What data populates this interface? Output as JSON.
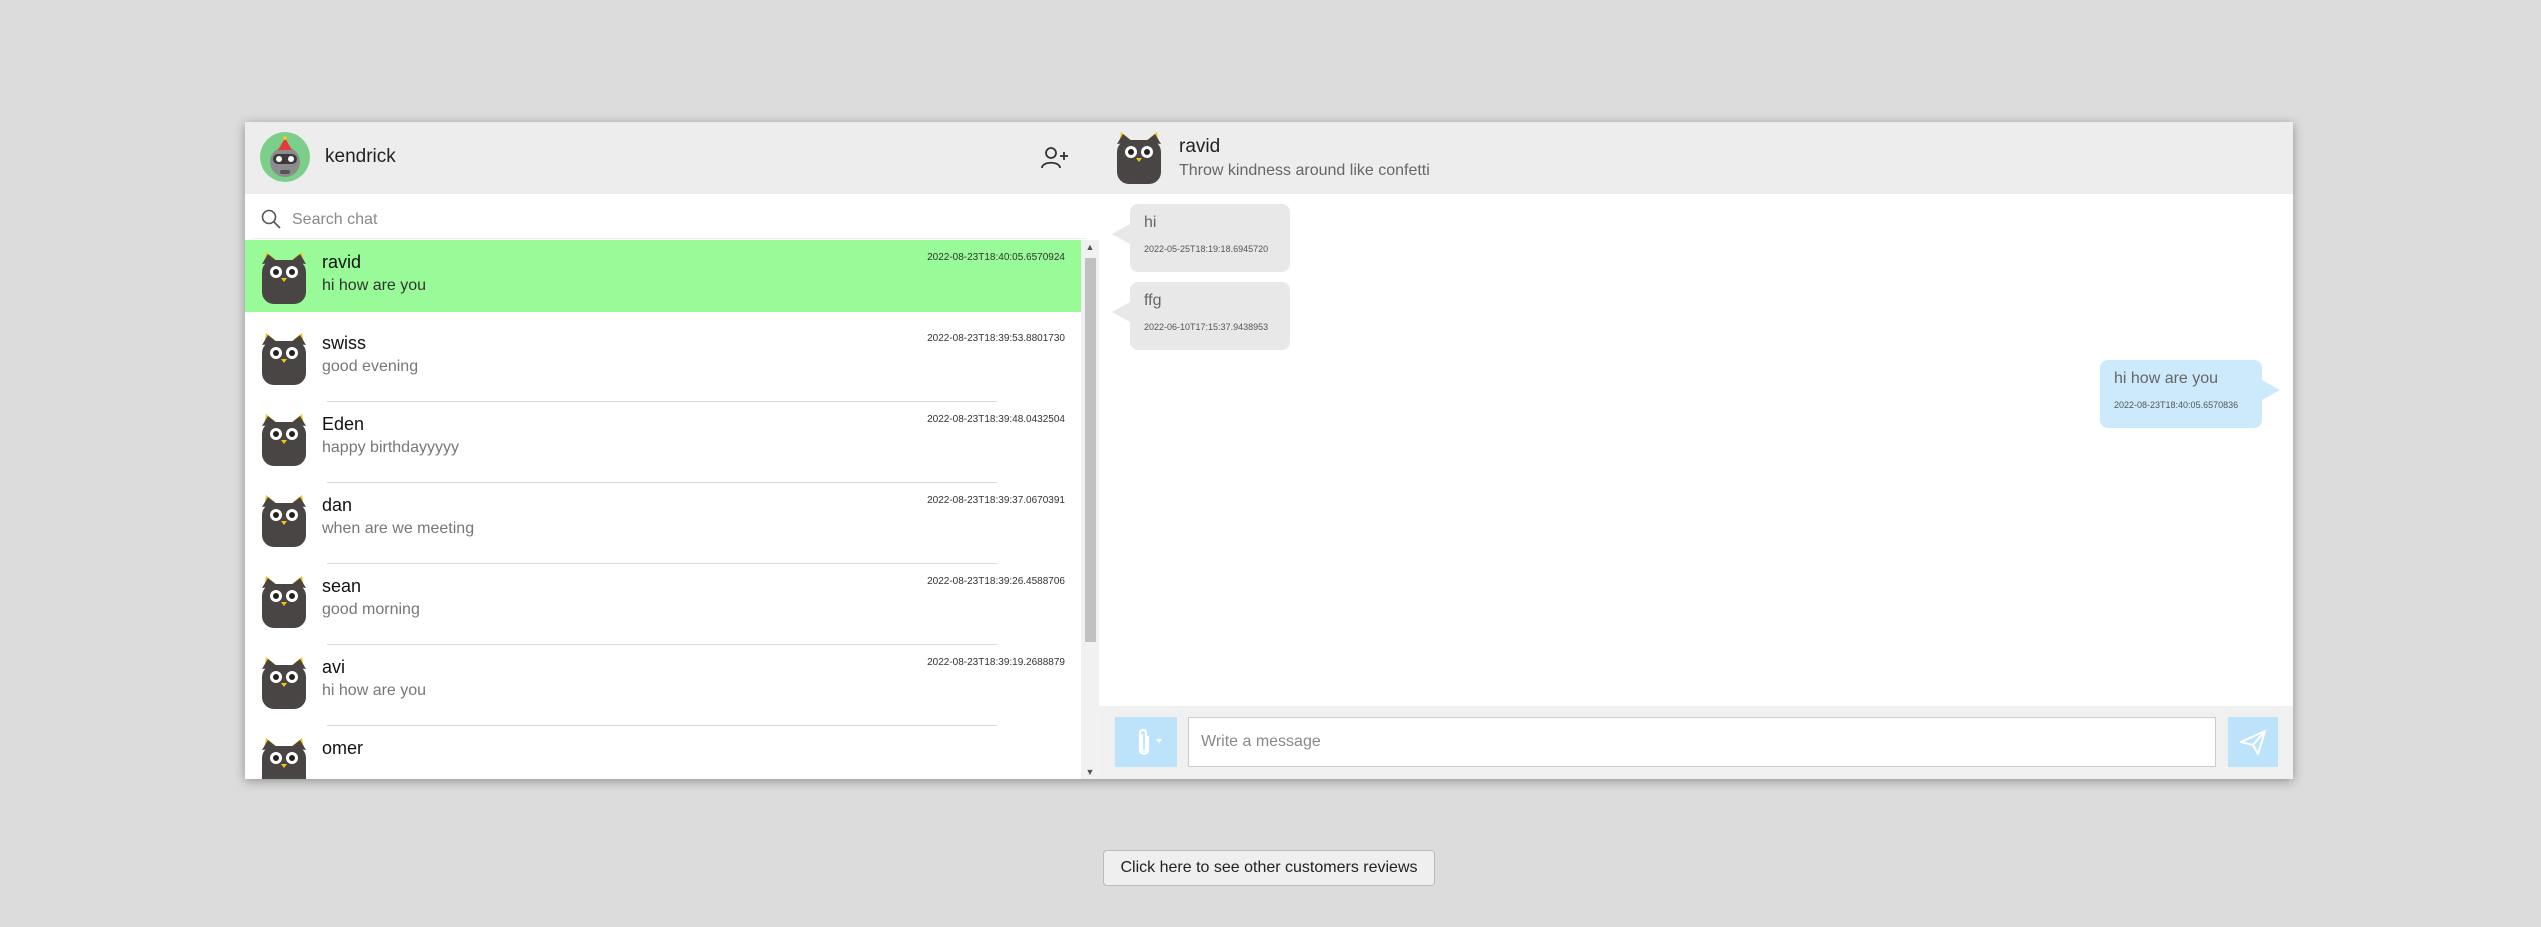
{
  "current_user": {
    "name": "kendrick",
    "avatar_icon": "robot-avatar-icon"
  },
  "search": {
    "placeholder": "Search chat",
    "value": ""
  },
  "chats": [
    {
      "name": "ravid",
      "preview": "hi how are you",
      "time": "2022-08-23T18:40:05.6570924",
      "active": true
    },
    {
      "name": "swiss",
      "preview": "good evening",
      "time": "2022-08-23T18:39:53.8801730"
    },
    {
      "name": "Eden",
      "preview": "happy birthdayyyyy",
      "time": "2022-08-23T18:39:48.0432504"
    },
    {
      "name": "dan",
      "preview": "when are we meeting",
      "time": "2022-08-23T18:39:37.0670391"
    },
    {
      "name": "sean",
      "preview": "good morning",
      "time": "2022-08-23T18:39:26.4588706"
    },
    {
      "name": "avi",
      "preview": "hi how are you",
      "time": "2022-08-23T18:39:19.2688879"
    },
    {
      "name": "omer",
      "preview": "",
      "time": ""
    }
  ],
  "conversation": {
    "contact_name": "ravid",
    "contact_status": "Throw kindness around like confetti",
    "messages": [
      {
        "text": "hi",
        "time": "2022-05-25T18:19:18.6945720",
        "direction": "in"
      },
      {
        "text": "ffg",
        "time": "2022-06-10T17:15:37.9438953",
        "direction": "in"
      },
      {
        "text": "hi how are you",
        "time": "2022-08-23T18:40:05.6570836",
        "direction": "out"
      }
    ]
  },
  "composer": {
    "placeholder": "Write a message",
    "value": ""
  },
  "footer": {
    "reviews_button": "Click here to see other customers reviews"
  },
  "colors": {
    "active_chat": "#98fb98",
    "incoming_bubble": "#e8e8e8",
    "outgoing_bubble": "#cdeafc",
    "action_button": "#bde3fb"
  }
}
